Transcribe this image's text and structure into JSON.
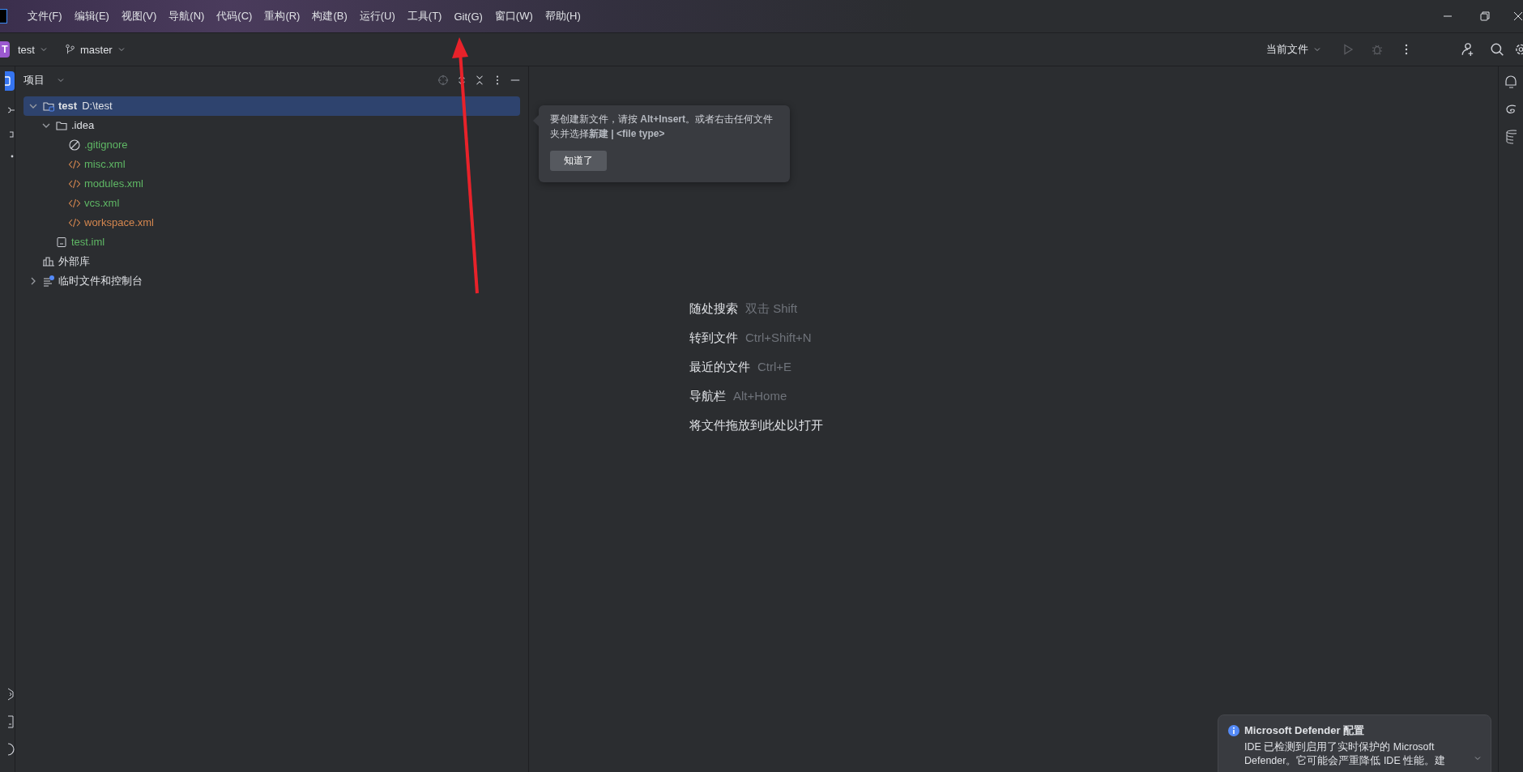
{
  "menu": [
    {
      "label": "文件(F)"
    },
    {
      "label": "编辑(E)"
    },
    {
      "label": "视图(V)"
    },
    {
      "label": "导航(N)"
    },
    {
      "label": "代码(C)"
    },
    {
      "label": "重构(R)"
    },
    {
      "label": "构建(B)"
    },
    {
      "label": "运行(U)"
    },
    {
      "label": "工具(T)"
    },
    {
      "label": "Git(G)"
    },
    {
      "label": "窗口(W)"
    },
    {
      "label": "帮助(H)"
    }
  ],
  "toolbar": {
    "project_badge": "T",
    "project": "test",
    "branch": "master",
    "run_config": "当前文件"
  },
  "project_panel": {
    "title": "项目",
    "tree": [
      {
        "kind": "project",
        "name": "test",
        "path": "D:\\test",
        "selected": true,
        "expanded": true,
        "children": [
          {
            "kind": "folder",
            "name": ".idea",
            "selected": false,
            "expanded": true,
            "children": [
              {
                "kind": "ignore",
                "name": ".gitignore",
                "selected": false,
                "color": "#5fb865"
              },
              {
                "kind": "xml",
                "name": "misc.xml",
                "selected": false,
                "color": "#5fb865"
              },
              {
                "kind": "xml",
                "name": "modules.xml",
                "selected": false,
                "color": "#5fb865"
              },
              {
                "kind": "xml",
                "name": "vcs.xml",
                "selected": false,
                "color": "#5fb865"
              },
              {
                "kind": "xml",
                "name": "workspace.xml",
                "selected": false,
                "color": "#d5874f"
              }
            ]
          },
          {
            "kind": "iml",
            "name": "test.iml",
            "selected": false,
            "color": "#5fb865"
          }
        ]
      },
      {
        "kind": "library",
        "name": "外部库",
        "selected": false
      },
      {
        "kind": "scratches",
        "name": "临时文件和控制台",
        "selected": false,
        "expanded": false
      }
    ]
  },
  "tip": {
    "text": "要创建新文件，请按 **Alt+Insert**。或者右击任何文件夹并选择**新建 | <file type>**",
    "button": "知道了"
  },
  "editor_hints": [
    {
      "label": "随处搜索",
      "shortcut": "双击 Shift"
    },
    {
      "label": "转到文件",
      "shortcut": "Ctrl+Shift+N"
    },
    {
      "label": "最近的文件",
      "shortcut": "Ctrl+E"
    },
    {
      "label": "导航栏",
      "shortcut": "Alt+Home"
    },
    {
      "label": "将文件拖放到此处以打开"
    }
  ],
  "notification": {
    "title": "Microsoft Defender 配置",
    "body": "IDE 已检测到启用了实时保护的 Microsoft Defender。它可能会严重降低 IDE 性能。建"
  }
}
